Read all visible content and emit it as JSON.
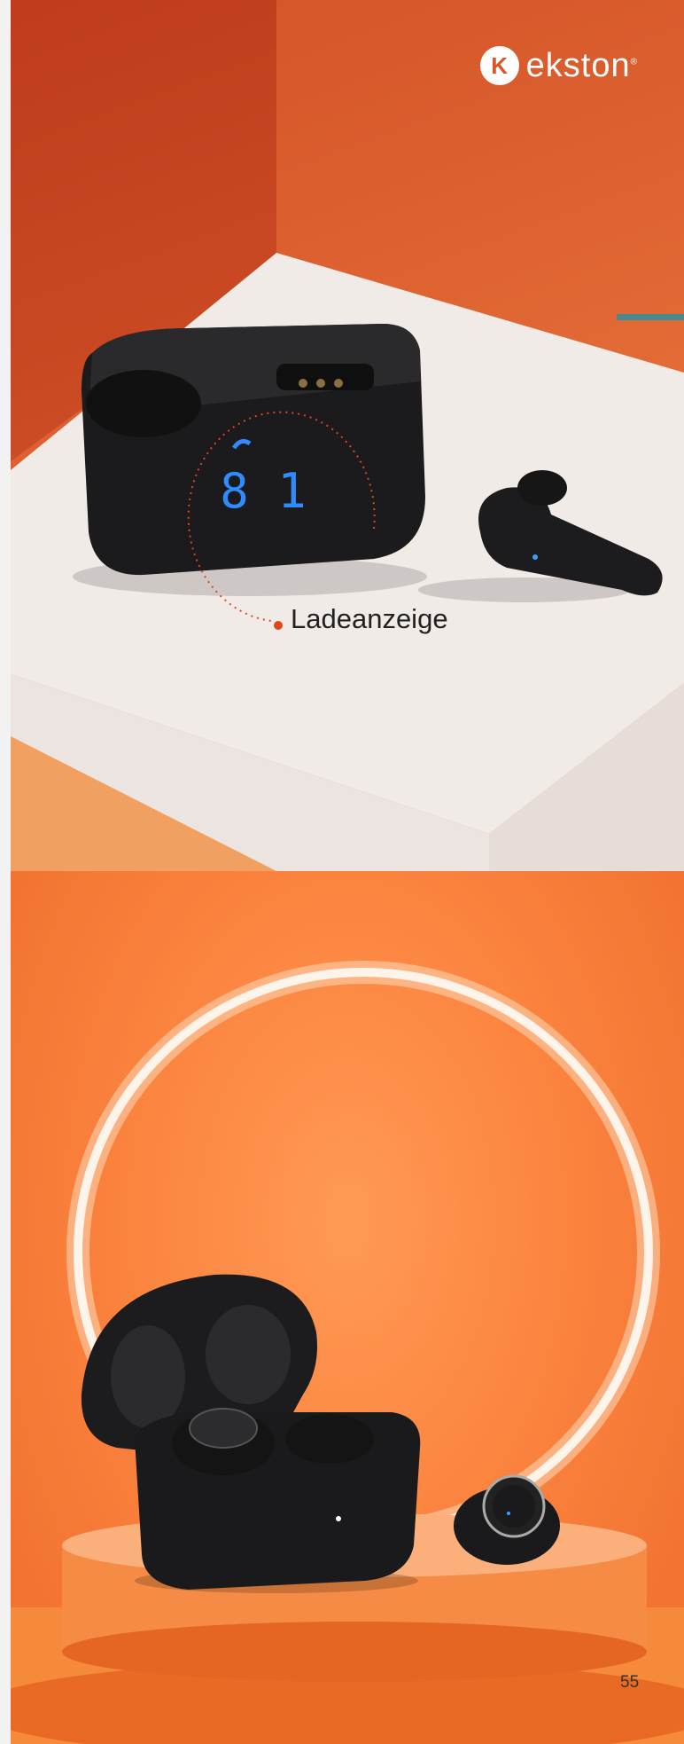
{
  "brand": {
    "name": "ekston",
    "mark": "®",
    "badge_letter": "K"
  },
  "callout": {
    "label": "Ladeanzeige"
  },
  "display": {
    "digits": "8 1"
  },
  "page": {
    "number": "55"
  },
  "colors": {
    "accent_bar": "#4a8a8e",
    "callout_dot": "#e0461a",
    "display_blue": "#2f8cff"
  }
}
